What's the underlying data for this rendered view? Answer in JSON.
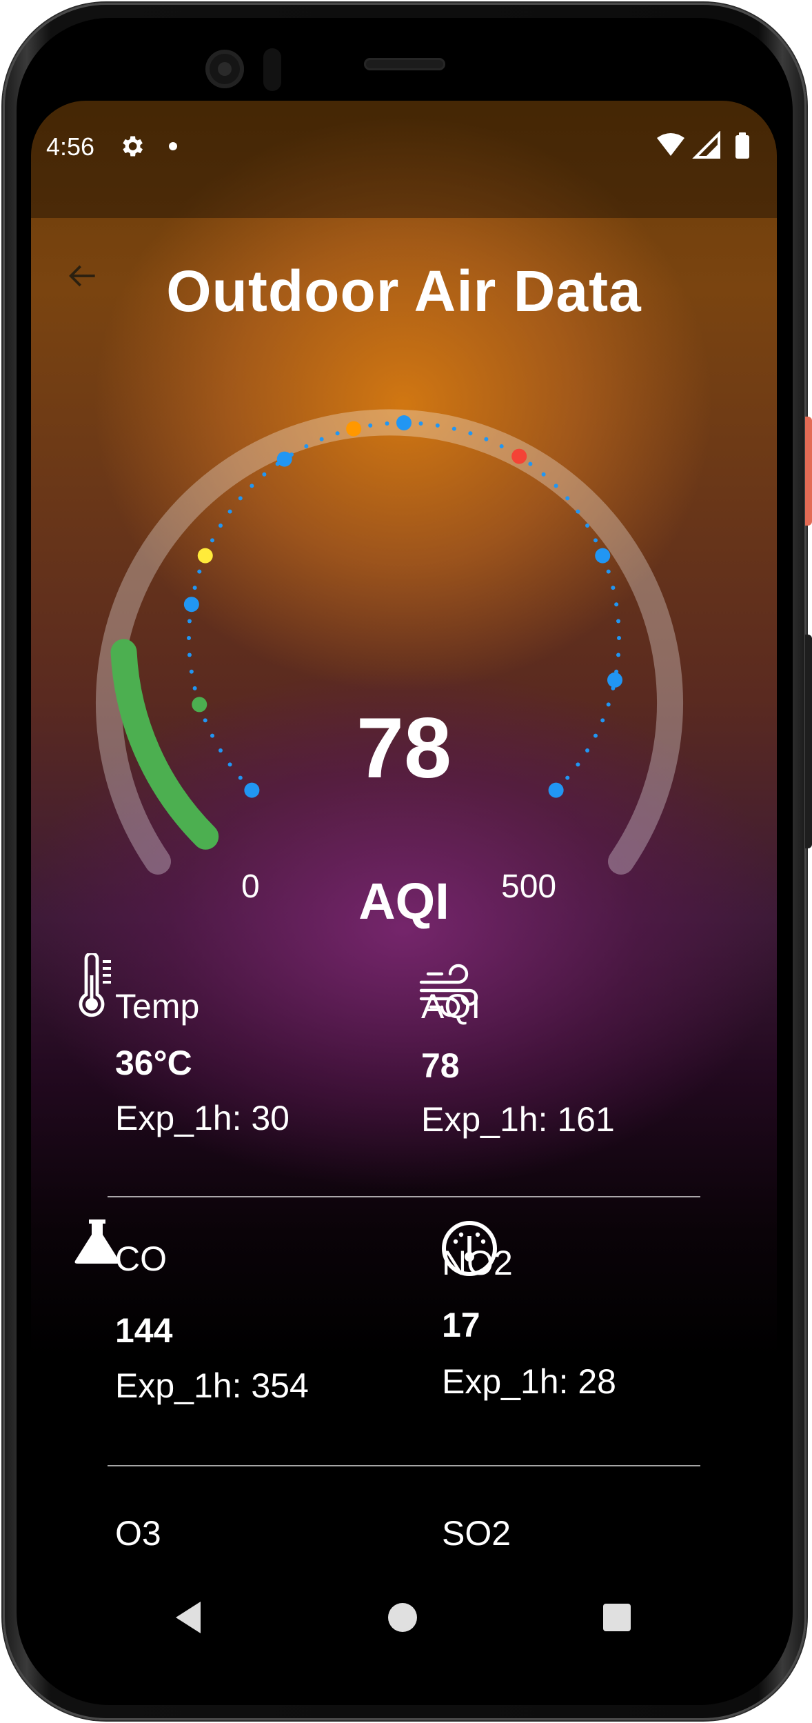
{
  "status_bar": {
    "time": "4:56",
    "icons": [
      "settings-gear-icon",
      "notification-dot-icon",
      "wifi-icon",
      "cellular-signal-icon",
      "battery-icon"
    ]
  },
  "header": {
    "back_icon": "arrow-back-icon",
    "title": "Outdoor Air Data"
  },
  "gauge": {
    "value": "78",
    "label": "AQI",
    "min_label": "0",
    "max_label": "500",
    "progress_fraction": 0.156,
    "colors": {
      "progress": "#4caf50",
      "track": "#ffffff",
      "tick_dots": "#2196f3",
      "good": "#4caf50",
      "moderate": "#ffeb3b",
      "unhealthy_sensitive": "#ff9800",
      "unhealthy": "#f44336"
    }
  },
  "metrics": [
    {
      "name": "Temp",
      "value": "36°C",
      "exp": "Exp_1h: 30",
      "icon": "thermometer-icon"
    },
    {
      "name": "AQI",
      "value": "78",
      "exp": "Exp_1h: 161",
      "icon": "wind-icon"
    },
    {
      "name": "CO",
      "value": "144",
      "exp": "Exp_1h: 354",
      "icon": "flask-icon"
    },
    {
      "name": "NO2",
      "value": "17",
      "exp": "Exp_1h: 28",
      "icon": "gauge-meter-icon"
    },
    {
      "name": "O3"
    },
    {
      "name": "SO2"
    }
  ],
  "nav_bar": {
    "icons": [
      "nav-back-icon",
      "nav-home-icon",
      "nav-recents-icon"
    ]
  }
}
